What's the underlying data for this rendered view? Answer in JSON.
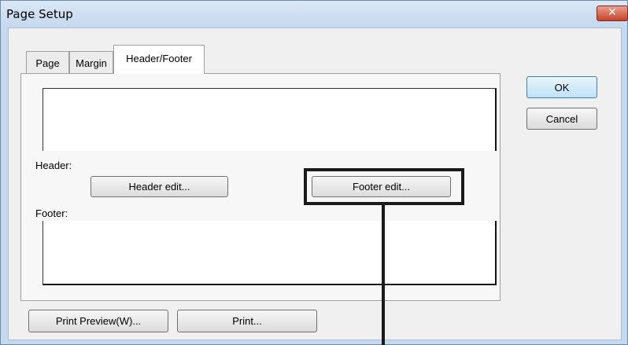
{
  "window": {
    "title": "Page Setup",
    "close_glyph": "✕"
  },
  "tabs": [
    {
      "label": "Page",
      "active": false
    },
    {
      "label": "Margin",
      "active": false
    },
    {
      "label": "Header/Footer",
      "active": true
    }
  ],
  "panel": {
    "header_label": "Header:",
    "footer_label": "Footer:",
    "header_edit_label": "Header edit...",
    "footer_edit_label": "Footer edit..."
  },
  "dialog_buttons": {
    "ok_label": "OK",
    "cancel_label": "Cancel",
    "print_preview_label": "Print Preview(W)...",
    "print_label": "Print..."
  },
  "annotation": {
    "highlighted_control": "Footer edit...",
    "color": "#1a1a1a"
  }
}
